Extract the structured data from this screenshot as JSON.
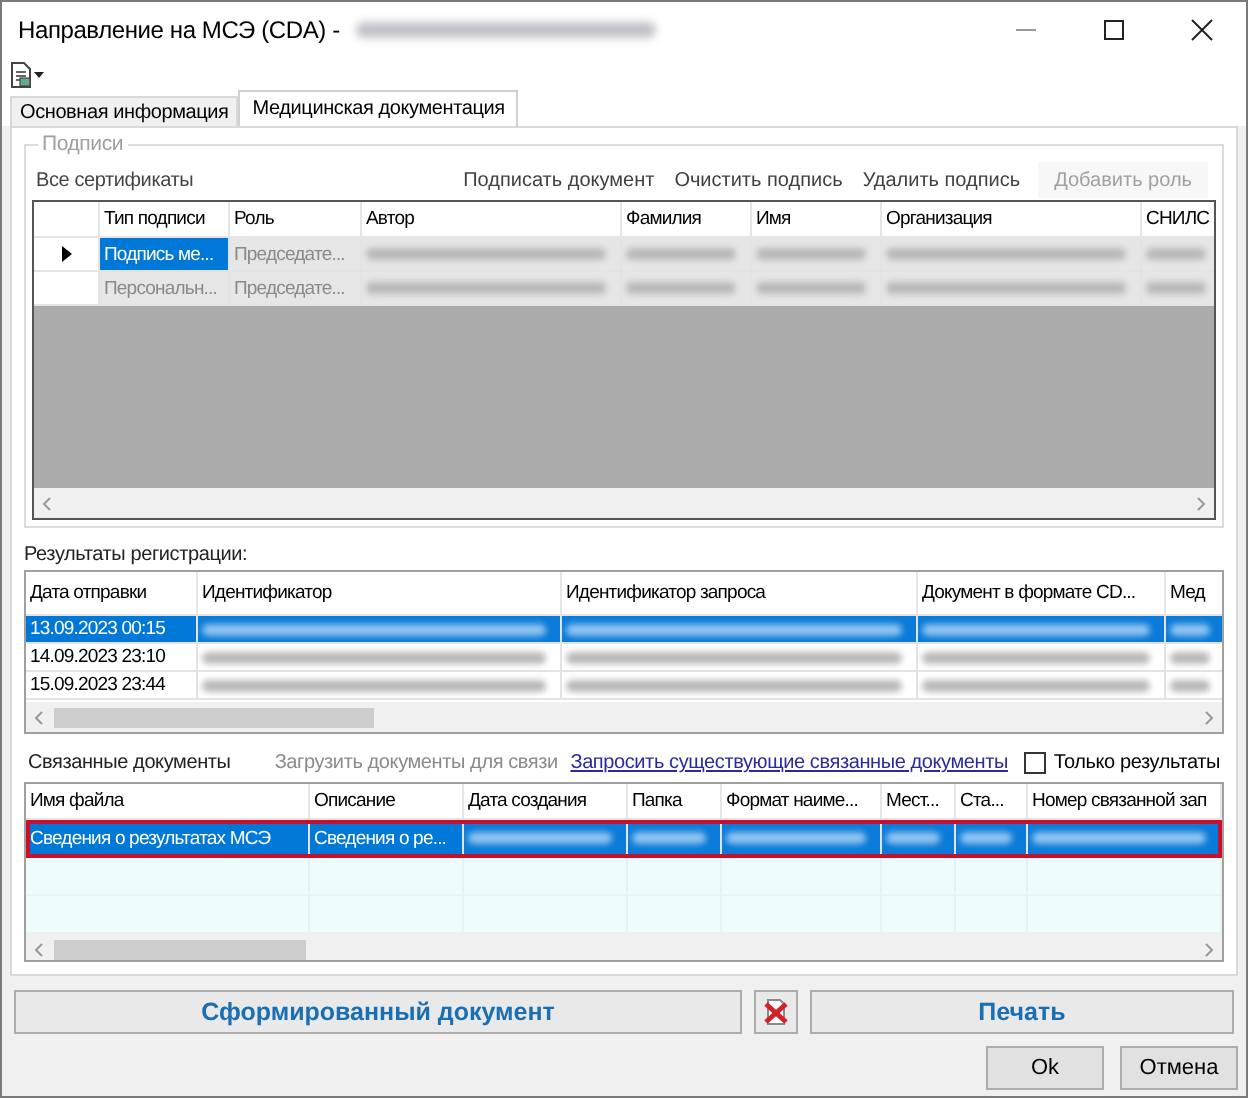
{
  "window": {
    "title": "Направление на МСЭ (CDA) -"
  },
  "tabs": [
    {
      "label": "Основная информация",
      "selected": false
    },
    {
      "label": "Медицинская документация",
      "selected": true
    }
  ],
  "signatures": {
    "group_title": "Подписи",
    "filter_label": "Все сертификаты",
    "actions": [
      {
        "label": "Подписать документ",
        "disabled": false
      },
      {
        "label": "Очистить подпись",
        "disabled": false
      },
      {
        "label": "Удалить подпись",
        "disabled": false
      },
      {
        "label": "Добавить роль",
        "disabled": true
      }
    ],
    "table": {
      "columns": [
        "Тип подписи",
        "Роль",
        "Автор",
        "Фамилия",
        "Имя",
        "Организация",
        "СНИЛС"
      ],
      "rows": [
        {
          "current": true,
          "cells": [
            {
              "text": "Подпись ме...",
              "selected": true,
              "readonly": false
            },
            {
              "text": "Председате...",
              "selected": false,
              "readonly": true
            }
          ]
        },
        {
          "current": false,
          "cells": [
            {
              "text": "Персональн...",
              "selected": false,
              "readonly": true
            },
            {
              "text": "Председате...",
              "selected": false,
              "readonly": true
            }
          ]
        }
      ]
    }
  },
  "registration": {
    "label": "Результаты регистрации:",
    "table": {
      "columns": [
        "Дата отправки",
        "Идентификатор",
        "Идентификатор запроса",
        "Документ в формате CD...",
        "Мед"
      ],
      "rows": [
        {
          "selected": true,
          "cells": [
            "13.09.2023 00:15"
          ]
        },
        {
          "selected": false,
          "cells": [
            "14.09.2023 23:10"
          ]
        },
        {
          "selected": false,
          "cells": [
            "15.09.2023 23:44"
          ]
        }
      ]
    }
  },
  "linked": {
    "label": "Связанные документы",
    "load_action": {
      "label": "Загрузить документы для связи",
      "disabled": true
    },
    "request_link": "Запросить существующие связанные документы",
    "only_results": {
      "label": "Только результаты",
      "checked": false
    },
    "table": {
      "columns": [
        "Имя файла",
        "Описание",
        "Дата создания",
        "Папка",
        "Формат наиме...",
        "Мест...",
        "Ста...",
        "Номер связанной зап"
      ],
      "rows": [
        {
          "selected": true,
          "highlighted": true,
          "cells": [
            "Сведения о результатах МСЭ",
            "Сведения о ре..."
          ]
        }
      ]
    }
  },
  "document_actions": {
    "generate": "Сформированный документ",
    "print": "Печать"
  },
  "buttons": [
    {
      "label": "Ok"
    },
    {
      "label": "Отмена"
    }
  ]
}
